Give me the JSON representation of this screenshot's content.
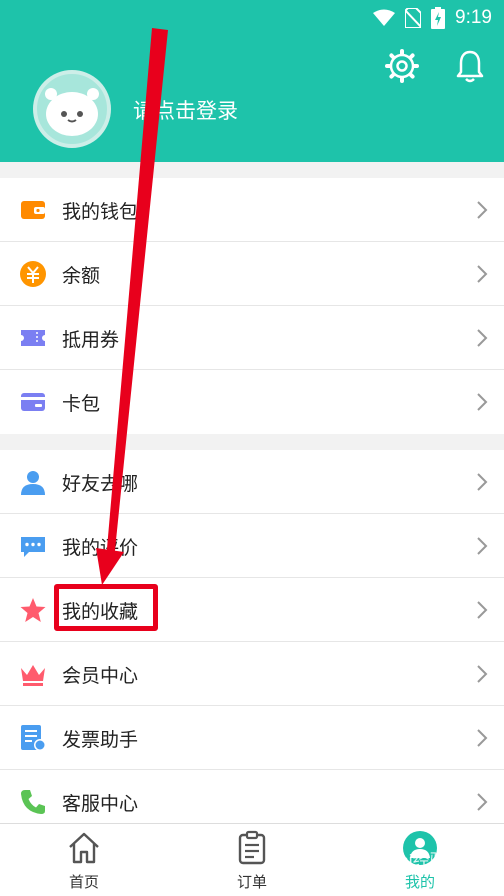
{
  "status_bar": {
    "time": "9:19"
  },
  "header": {
    "login_prompt": "请点击登录"
  },
  "group1": [
    {
      "label": "我的钱包",
      "icon": "wallet-icon",
      "color": "#ff8a00"
    },
    {
      "label": "余额",
      "icon": "yuan-coin-icon",
      "color": "#ff9500"
    },
    {
      "label": "抵用券",
      "icon": "coupon-icon",
      "color": "#7b7ff2"
    },
    {
      "label": "卡包",
      "icon": "card-icon",
      "color": "#7b7ff2"
    }
  ],
  "group2": [
    {
      "label": "好友去哪",
      "icon": "person-icon",
      "color": "#4a9df0"
    },
    {
      "label": "我的评价",
      "icon": "chat-bubble-icon",
      "color": "#4a9df0"
    },
    {
      "label": "我的收藏",
      "icon": "star-icon",
      "color": "#ff5b6d"
    },
    {
      "label": "会员中心",
      "icon": "crown-icon",
      "color": "#ff5b6d"
    },
    {
      "label": "发票助手",
      "icon": "invoice-icon",
      "color": "#4a9df0"
    },
    {
      "label": "客服中心",
      "icon": "phone-icon",
      "color": "#5bc455"
    }
  ],
  "tabbar": {
    "home": "首页",
    "orders": "订单",
    "mine": "我的"
  },
  "colors": {
    "brand": "#1ec3aa",
    "annotation": "#e8001c"
  },
  "watermark": "Bai经验"
}
